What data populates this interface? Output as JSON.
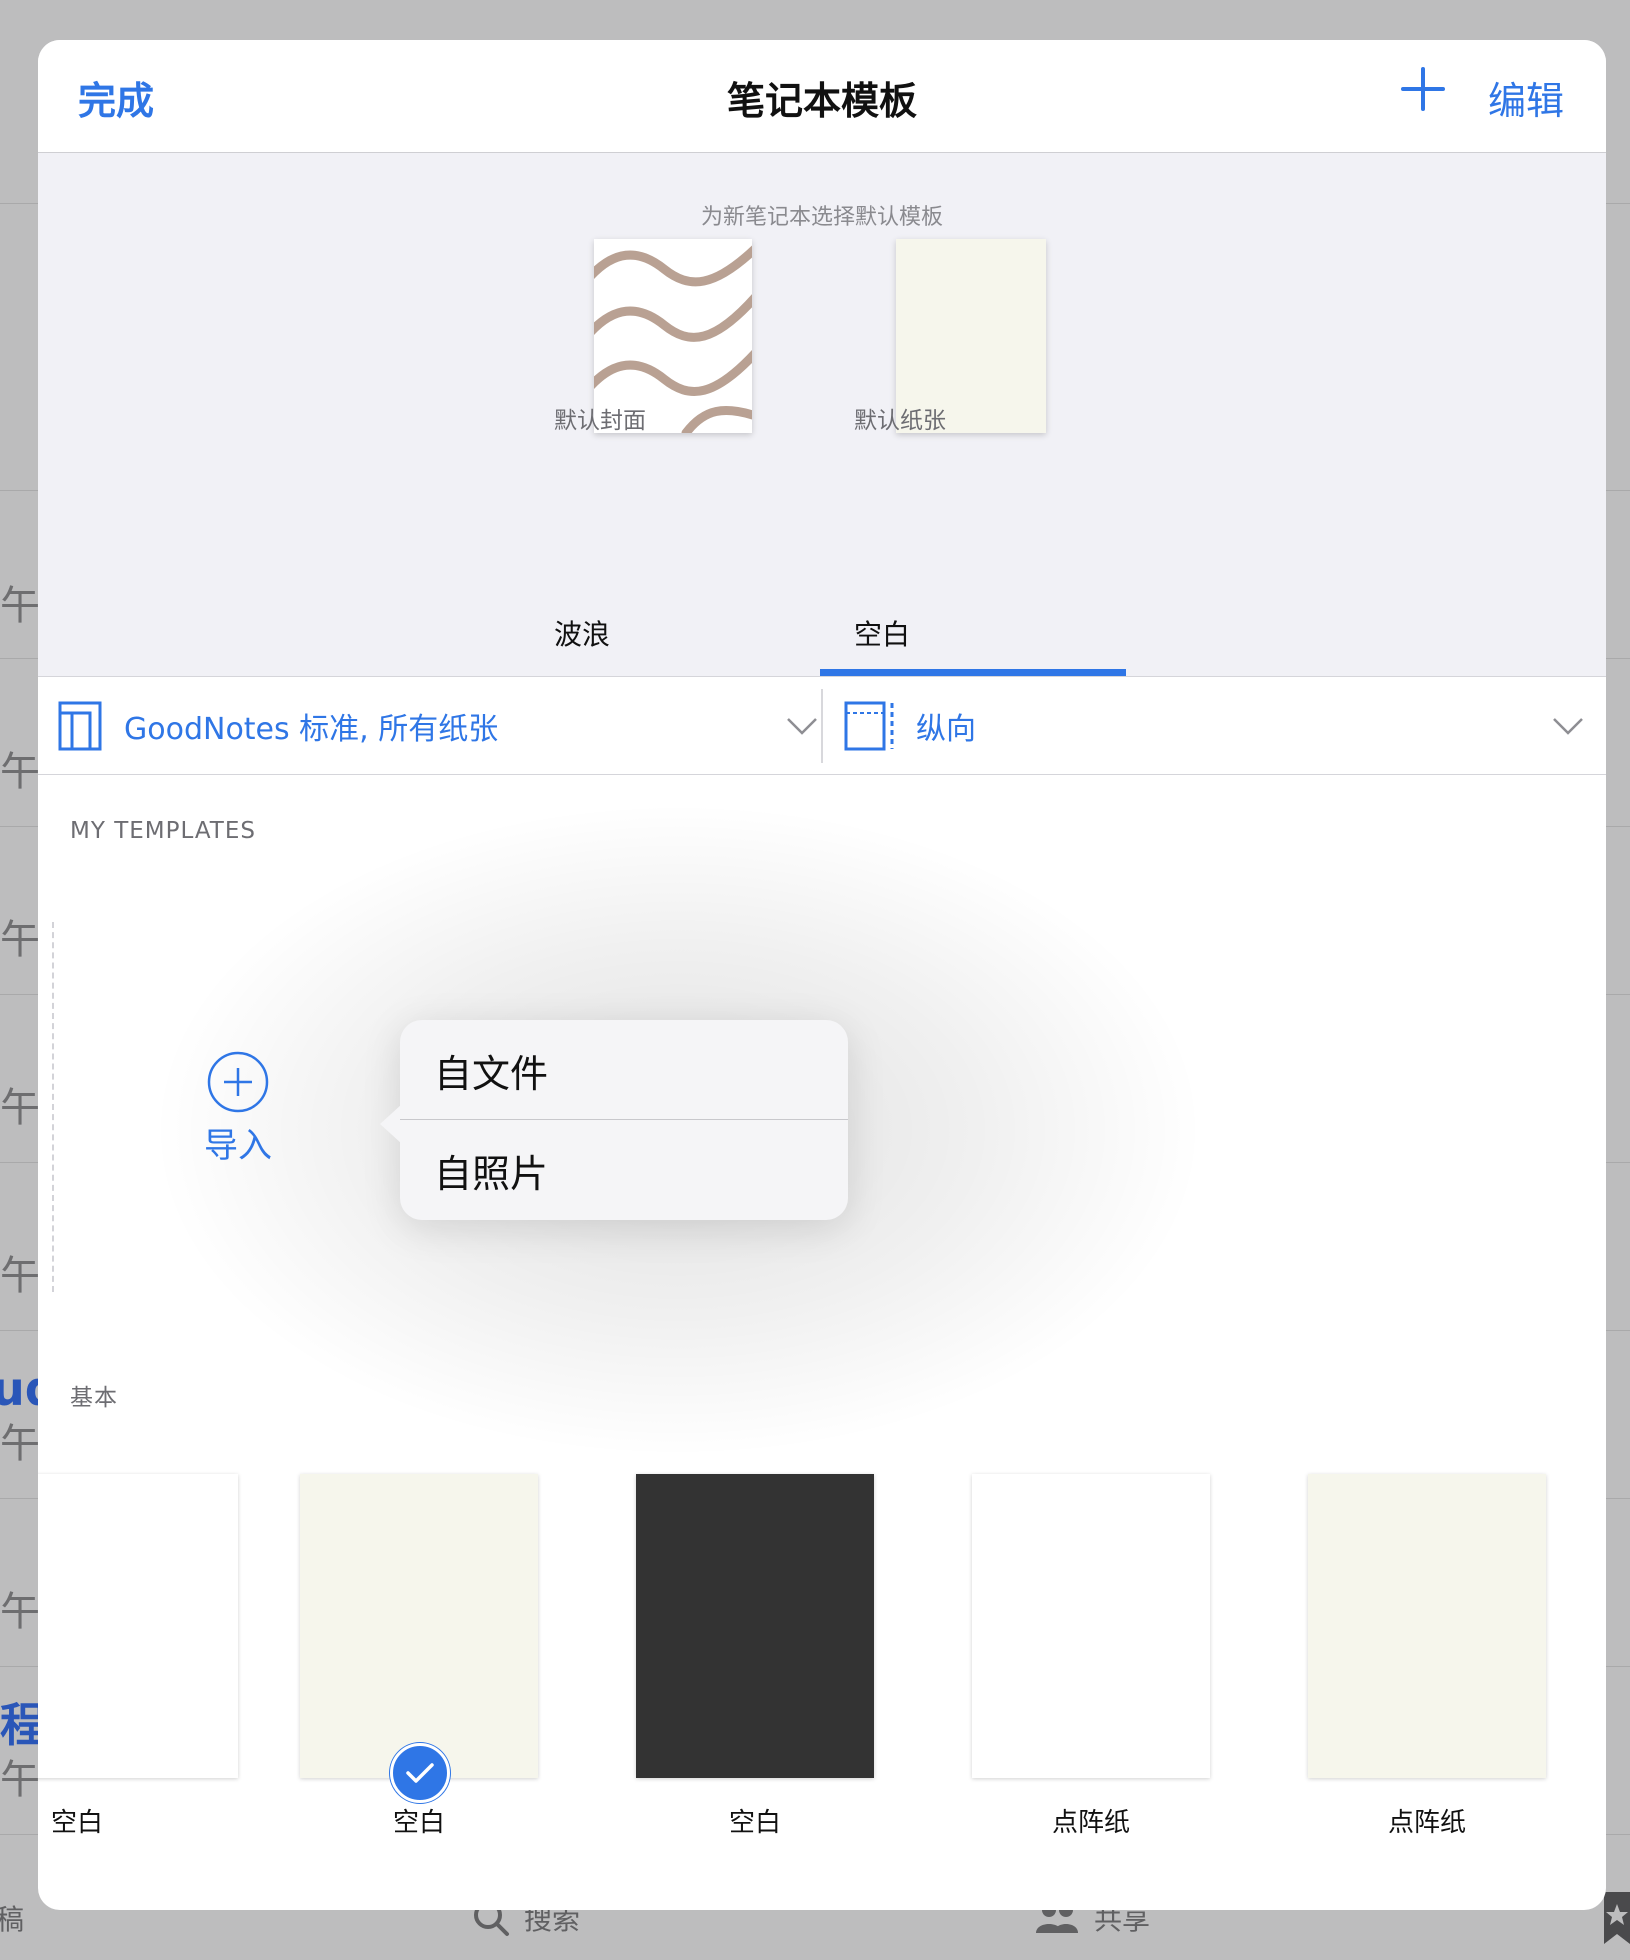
{
  "background_app": {
    "row_char": "午",
    "blue_chars": [
      "ud",
      "程"
    ],
    "tabs": [
      {
        "icon": "search-icon",
        "label": "搜索"
      },
      {
        "icon": "people-icon",
        "label": "共享"
      }
    ],
    "left_tab_fragment": "稿"
  },
  "nav": {
    "done_label": "完成",
    "title": "笔记本模板",
    "add_icon": "plus-icon",
    "edit_label": "编辑"
  },
  "header": {
    "hint": "为新笔记本选择默认模板",
    "cover_label": "默认封面",
    "paper_label": "默认纸张",
    "segments": [
      "波浪",
      "空白"
    ],
    "selected_segment": "空白"
  },
  "filters": {
    "template_set": "GoodNotes 标准, 所有纸张",
    "orientation": "纵向"
  },
  "my_templates": {
    "section_title": "MY TEMPLATES",
    "import_label": "导入"
  },
  "popover": {
    "items": [
      "自文件",
      "自照片"
    ]
  },
  "basic": {
    "section_title": "基本",
    "cards": [
      {
        "label": "空白",
        "color": "#ffffff"
      },
      {
        "label": "空白",
        "color": "#f6f6ec",
        "selected": true
      },
      {
        "label": "空白",
        "color": "#333333"
      },
      {
        "label": "点阵纸",
        "color": "#ffffff"
      },
      {
        "label": "点阵纸",
        "color": "#f6f6ec"
      }
    ]
  },
  "colors": {
    "accent": "#2f76e6",
    "wave": "#b9a193"
  }
}
